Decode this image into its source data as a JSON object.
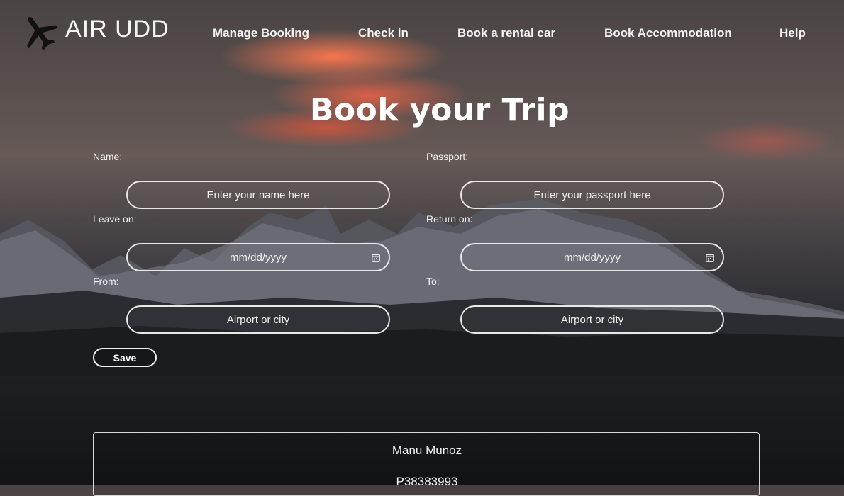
{
  "brand": {
    "name": "AIR UDD",
    "logo_icon": "airplane-icon"
  },
  "nav": {
    "items": [
      {
        "label": "Manage Booking"
      },
      {
        "label": "Check in"
      },
      {
        "label": "Book a rental car"
      },
      {
        "label": "Book Accommodation"
      },
      {
        "label": "Help"
      }
    ]
  },
  "form": {
    "title": "Book your Trip",
    "name": {
      "label": "Name:",
      "placeholder": "Enter your name here"
    },
    "passport": {
      "label": "Passport:",
      "placeholder": "Enter your passport here"
    },
    "leave_on": {
      "label": "Leave on:",
      "placeholder": "mm/dd/yyyy",
      "icon": "calendar-icon"
    },
    "return_on": {
      "label": "Return on:",
      "placeholder": "mm/dd/yyyy",
      "icon": "calendar-icon"
    },
    "from": {
      "label": "From:",
      "placeholder": "Airport or city"
    },
    "to": {
      "label": "To:",
      "placeholder": "Airport or city"
    },
    "save_label": "Save"
  },
  "result": {
    "name": "Manu Munoz",
    "passport": "P38383993"
  },
  "colors": {
    "text": "#ffffff",
    "border": "#e8e8e8"
  }
}
